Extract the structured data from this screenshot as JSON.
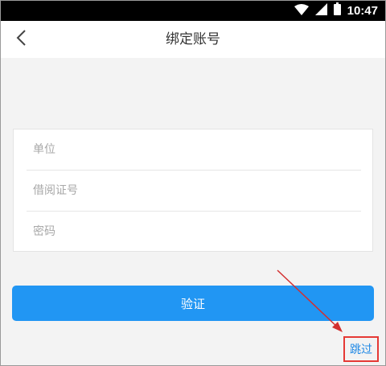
{
  "status_bar": {
    "time": "10:47",
    "icons": [
      "wifi-icon",
      "signal-icon",
      "battery-icon"
    ]
  },
  "nav": {
    "back_icon": "chevron-left-icon",
    "title": "绑定账号"
  },
  "form": {
    "unit_placeholder": "单位",
    "card_placeholder": "借阅证号",
    "password_placeholder": "密码"
  },
  "verify_button": {
    "label": "验证",
    "color": "#2196f3"
  },
  "skip": {
    "label": "跳过",
    "highlight_color": "#e53935"
  },
  "annotation": {
    "arrow_color": "#d32f2f"
  }
}
